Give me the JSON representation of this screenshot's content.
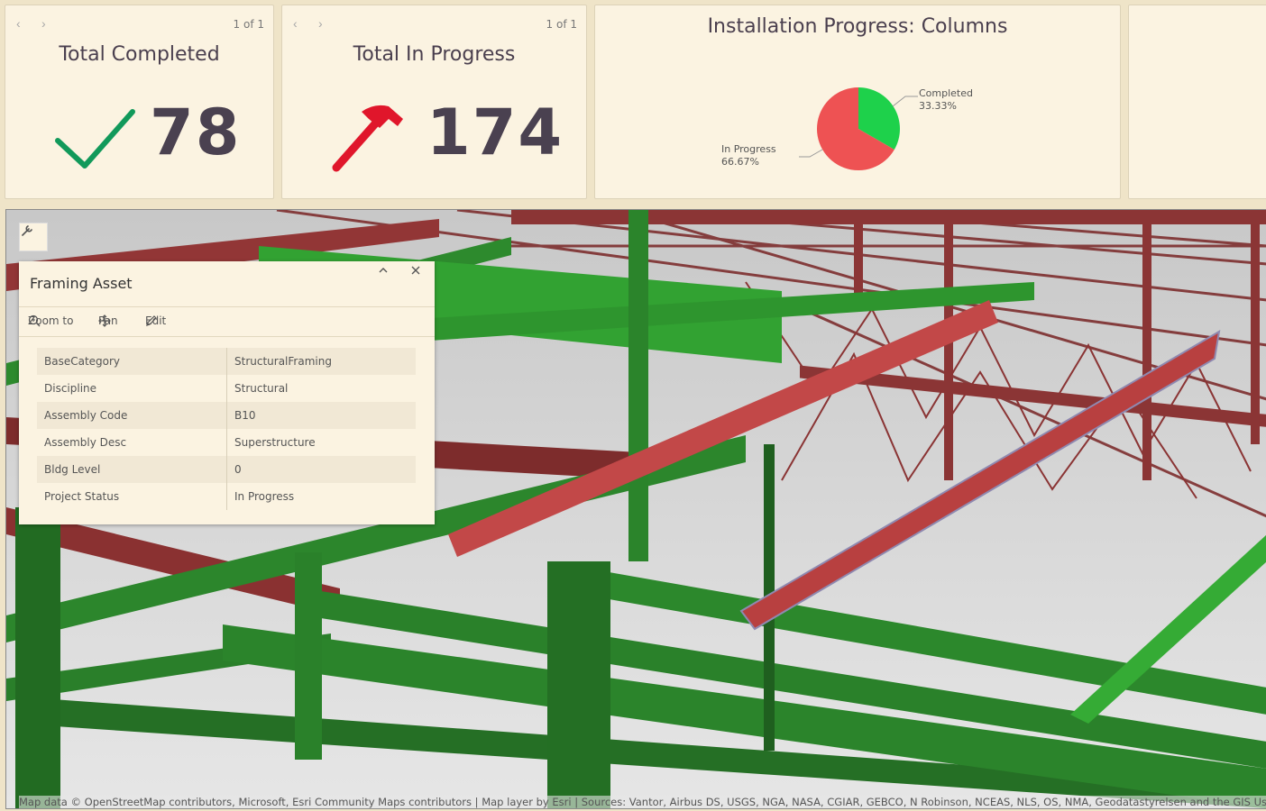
{
  "cards": {
    "completed": {
      "pager": "1 of 1",
      "title": "Total Completed",
      "value": "78",
      "icon": "check-icon"
    },
    "in_progress": {
      "pager": "1 of 1",
      "title": "Total In Progress",
      "value": "174",
      "icon": "hammer-icon"
    }
  },
  "chart_data": {
    "type": "pie",
    "title": "Installation Progress: Columns",
    "slices": [
      {
        "label": "Completed",
        "percent_label": "33.33%",
        "value": 33.33,
        "color": "#1ed14b"
      },
      {
        "label": "In Progress",
        "percent_label": "66.67%",
        "value": 66.67,
        "color": "#ee5253"
      }
    ]
  },
  "popup": {
    "title": "Framing Asset",
    "actions": {
      "zoom": "Zoom to",
      "pan": "Pan",
      "edit": "Edit"
    },
    "attributes": [
      {
        "key": "BaseCategory",
        "value": "StructuralFraming"
      },
      {
        "key": "Discipline",
        "value": "Structural"
      },
      {
        "key": "Assembly Code",
        "value": "B10"
      },
      {
        "key": "Assembly Desc",
        "value": "Superstructure"
      },
      {
        "key": "Bldg Level",
        "value": "0"
      },
      {
        "key": "Project Status",
        "value": "In Progress"
      }
    ]
  },
  "map": {
    "attribution": "Map data © OpenStreetMap contributors, Microsoft, Esri Community Maps contributors | Map layer by Esri | Sources: Vantor, Airbus DS, USGS, NGA, NASA, CGIAR, GEBCO, N Robinson, NCEAS, NLS, OS, NMA, Geodatastyrelsen and the GIS User Community"
  },
  "colors": {
    "completed": "#1ed14b",
    "in_progress": "#ee5253",
    "steel_green": "#2f8f2f",
    "steel_red": "#9b3a3a"
  }
}
